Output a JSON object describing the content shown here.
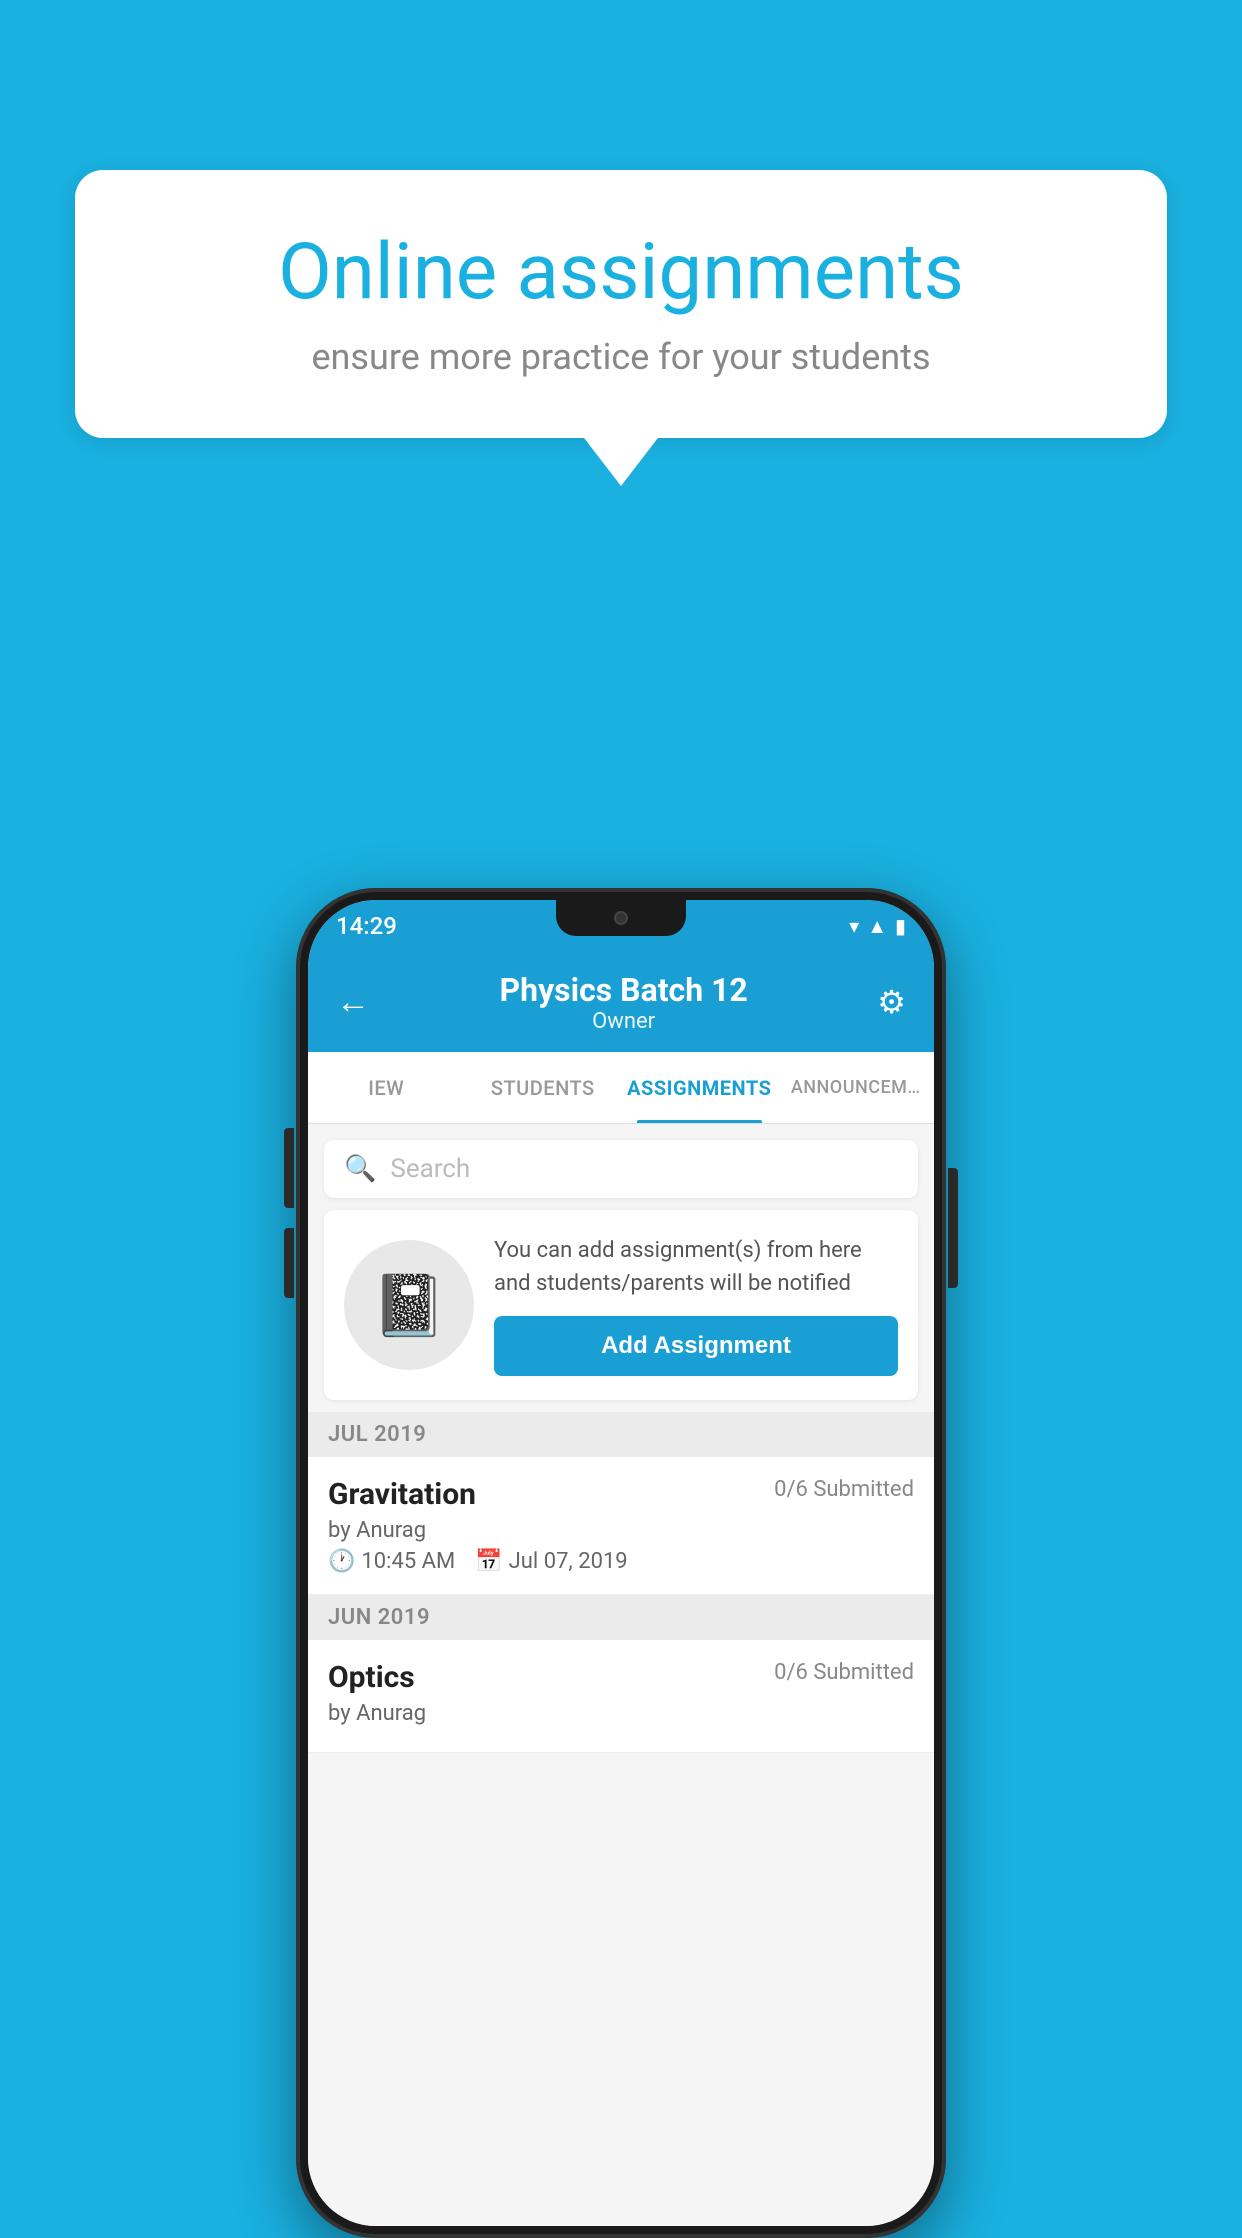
{
  "background": {
    "color": "#1ab0e0"
  },
  "speech_bubble": {
    "title": "Online assignments",
    "subtitle": "ensure more practice for your students"
  },
  "status_bar": {
    "time": "14:29",
    "icons": [
      "wifi",
      "signal",
      "battery"
    ]
  },
  "app_header": {
    "title": "Physics Batch 12",
    "subtitle": "Owner",
    "back_label": "←",
    "settings_label": "⚙"
  },
  "tabs": [
    {
      "label": "IEW",
      "active": false
    },
    {
      "label": "STUDENTS",
      "active": false
    },
    {
      "label": "ASSIGNMENTS",
      "active": true
    },
    {
      "label": "ANNOUNCEM…",
      "active": false
    }
  ],
  "search": {
    "placeholder": "Search"
  },
  "empty_state": {
    "text": "You can add assignment(s) from here and students/parents will be notified",
    "button_label": "Add Assignment"
  },
  "sections": [
    {
      "label": "JUL 2019",
      "assignments": [
        {
          "name": "Gravitation",
          "submitted": "0/6 Submitted",
          "by": "by Anurag",
          "time": "10:45 AM",
          "date": "Jul 07, 2019"
        }
      ]
    },
    {
      "label": "JUN 2019",
      "assignments": [
        {
          "name": "Optics",
          "submitted": "0/6 Submitted",
          "by": "by Anurag",
          "time": "",
          "date": ""
        }
      ]
    }
  ]
}
